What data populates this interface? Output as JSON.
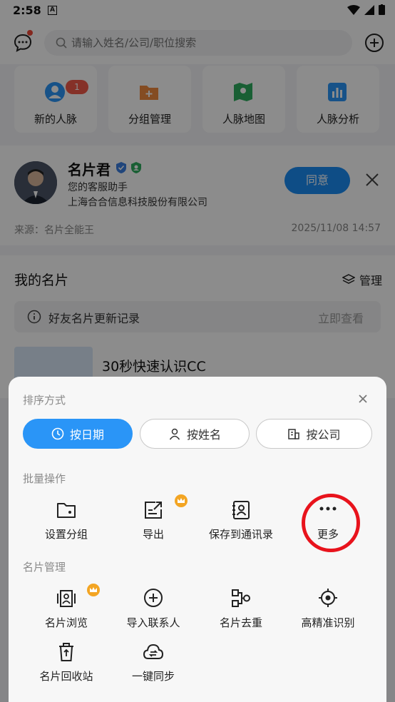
{
  "status_bar": {
    "time": "2:58",
    "notification_icon": "A"
  },
  "header": {
    "search_placeholder": "请输入姓名/公司/职位搜索"
  },
  "quick_actions": [
    {
      "label": "新的人脉",
      "icon": "contacts-icon",
      "badge": "1"
    },
    {
      "label": "分组管理",
      "icon": "folder-add-icon"
    },
    {
      "label": "人脉地图",
      "icon": "map-icon"
    },
    {
      "label": "人脉分析",
      "icon": "chart-icon"
    }
  ],
  "friend_request": {
    "name": "名片君",
    "subtitle": "您的客服助手",
    "company": "上海合合信息科技股份有限公司",
    "agree_label": "同意",
    "source": "来源：名片全能王",
    "date": "2025/11/08 14:57"
  },
  "my_cards": {
    "title": "我的名片",
    "manage_label": "管理",
    "update_text": "好友名片更新记录",
    "view_label": "立即查看",
    "card_title": "30秒快速认识CC"
  },
  "sheet": {
    "sort_title": "排序方式",
    "sort_options": [
      {
        "label": "按日期",
        "icon": "clock-icon",
        "active": true
      },
      {
        "label": "按姓名",
        "icon": "person-icon",
        "active": false
      },
      {
        "label": "按公司",
        "icon": "building-icon",
        "active": false
      }
    ],
    "batch_title": "批量操作",
    "batch_ops": [
      {
        "label": "设置分组",
        "icon": "folder-icon"
      },
      {
        "label": "导出",
        "icon": "export-icon",
        "crown": true
      },
      {
        "label": "保存到通讯录",
        "icon": "contact-book-icon"
      },
      {
        "label": "更多",
        "icon": "more-icon",
        "highlighted": true
      }
    ],
    "manage_title": "名片管理",
    "manage_ops": [
      {
        "label": "名片浏览",
        "icon": "card-browse-icon",
        "crown": true
      },
      {
        "label": "导入联系人",
        "icon": "plus-circle-icon"
      },
      {
        "label": "名片去重",
        "icon": "dedupe-icon"
      },
      {
        "label": "高精准识别",
        "icon": "target-icon"
      },
      {
        "label": "名片回收站",
        "icon": "trash-icon"
      },
      {
        "label": "一键同步",
        "icon": "cloud-sync-icon"
      }
    ]
  },
  "colors": {
    "accent": "#2a95f7",
    "highlight_ring": "#e8131c",
    "crown": "#f3a523"
  }
}
